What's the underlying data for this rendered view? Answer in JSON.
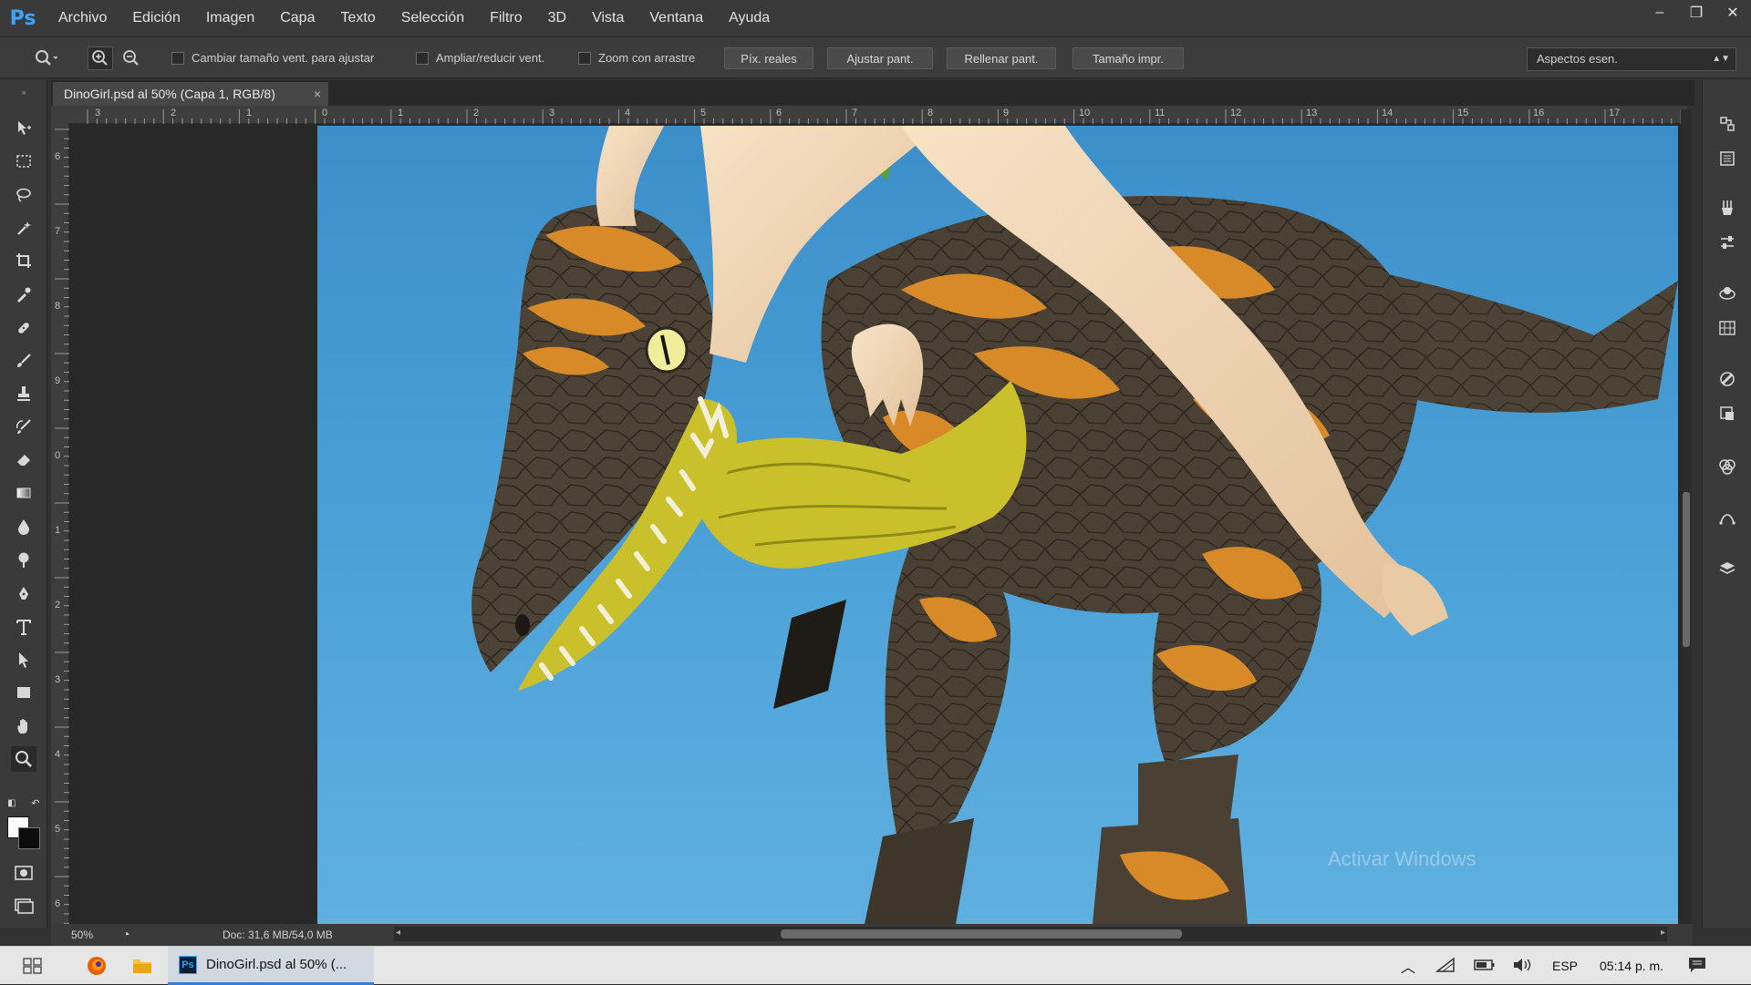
{
  "app": {
    "logo": "Ps"
  },
  "menu": [
    "Archivo",
    "Edición",
    "Imagen",
    "Capa",
    "Texto",
    "Selección",
    "Filtro",
    "3D",
    "Vista",
    "Ventana",
    "Ayuda"
  ],
  "window_controls": {
    "minimize": "–",
    "restore": "❐",
    "close": "✕"
  },
  "options": {
    "resize_windows_label": "Cambiar tamaño vent. para ajustar",
    "zoom_all_windows_label": "Ampliar/reducir vent.",
    "scrubby_zoom_label": "Zoom con arrastre",
    "actual_pixels_label": "Píx. reales",
    "fit_screen_label": "Ajustar pant.",
    "fill_screen_label": "Rellenar pant.",
    "print_size_label": "Tamaño impr.",
    "workspace": "Aspectos esen."
  },
  "document": {
    "tab_title": "DinoGirl.psd al 50% (Capa 1, RGB/8)",
    "close": "×"
  },
  "ruler": {
    "horizontal_ticks": [
      "3",
      "2",
      "1",
      "0",
      "1",
      "2",
      "3",
      "4",
      "5",
      "6",
      "7",
      "8",
      "9",
      "10",
      "11",
      "12",
      "13",
      "14",
      "15",
      "16",
      "17"
    ],
    "vertical_ticks": [
      "6",
      "7",
      "8",
      "9",
      "0",
      "1",
      "2",
      "3",
      "4",
      "5",
      "6"
    ]
  },
  "status": {
    "zoom": "50%",
    "doc_size": "Doc: 31,6 MB/54,0 MB"
  },
  "watermark": {
    "line1": "Activar Windows"
  },
  "taskbar": {
    "active_app_label": "DinoGirl.psd al 50% (...",
    "language": "ESP",
    "clock": "05:14 p. m."
  }
}
